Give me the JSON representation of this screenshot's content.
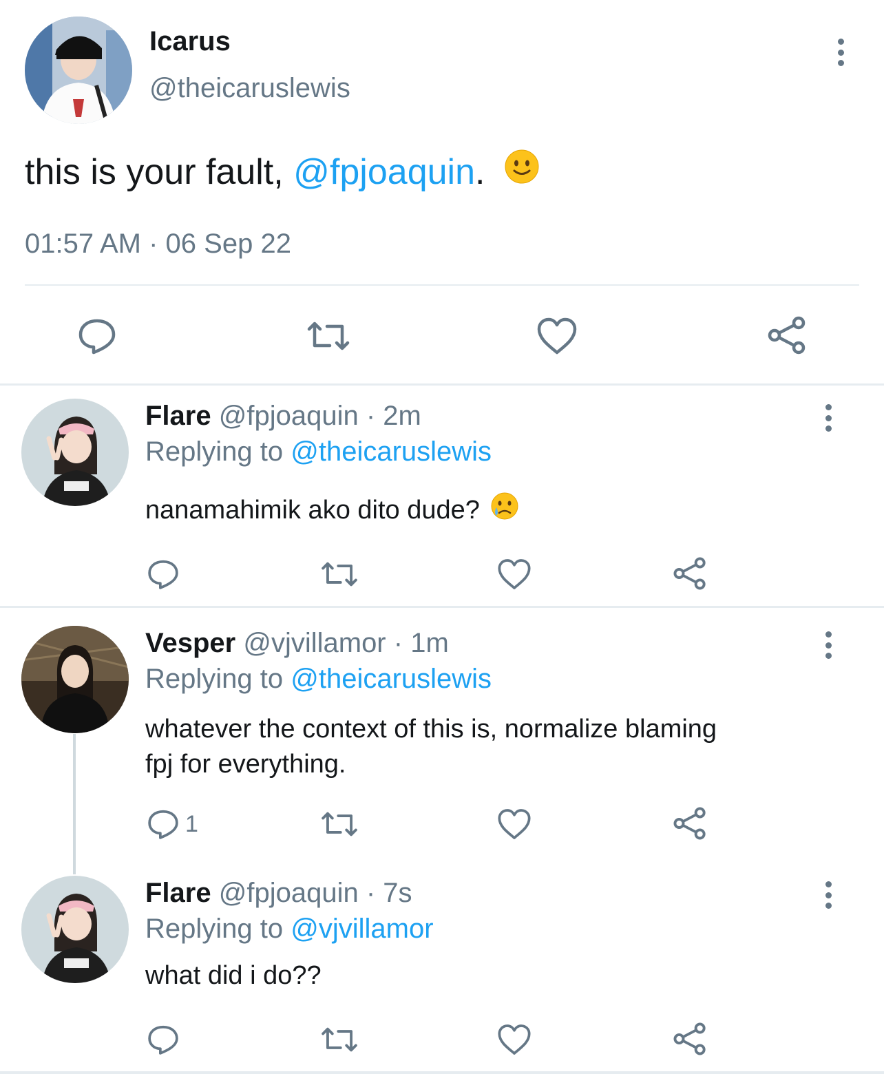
{
  "tweet": {
    "author_name": "Icarus",
    "author_handle": "@theicaruslewis",
    "text_prefix": "this is your fault, ",
    "mention": "@fpjoaquin",
    "text_suffix": ".",
    "emoji_icon": "slightly-smiling-face-icon",
    "timestamp": "01:57 AM · 06 Sep 22"
  },
  "replies": [
    {
      "author_name": "Flare",
      "author_handle": "@fpjoaquin",
      "time": "· 2m",
      "replying_to_label": "Replying to ",
      "replying_to": "@theicaruslewis",
      "text": "nanamahimik ako dito dude?",
      "emoji_icon": "crying-face-icon",
      "reply_count": ""
    },
    {
      "author_name": "Vesper",
      "author_handle": "@vjvillamor",
      "time": "· 1m",
      "replying_to_label": "Replying to ",
      "replying_to": "@theicaruslewis",
      "text_line1": "whatever the context of this is, normalize blaming",
      "text_line2": "fpj for everything.",
      "reply_count": "1"
    },
    {
      "author_name": "Flare",
      "author_handle": "@fpjoaquin",
      "time": "· 7s",
      "replying_to_label": "Replying to ",
      "replying_to": "@vjvillamor",
      "text": "what did i do??",
      "reply_count": ""
    }
  ],
  "colors": {
    "accent": "#1da1f2",
    "muted": "#657786",
    "divider": "#e6ecf0",
    "text": "#14171a"
  }
}
